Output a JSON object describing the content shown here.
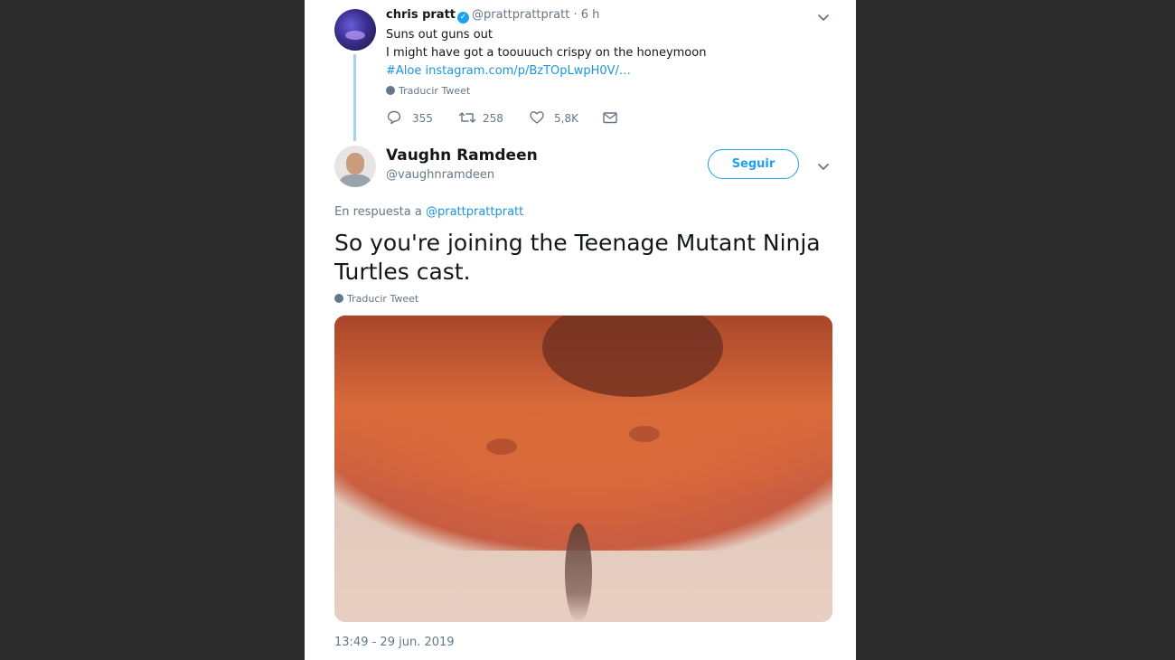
{
  "parent_tweet": {
    "display_name": "chris pratt",
    "handle": "@prattprattpratt",
    "time": "· 6 h",
    "lines": [
      "Suns out guns out",
      "I might have got a toouuuch crispy on the honeymoon"
    ],
    "hashtag": "#Aloe",
    "link": "instagram.com/p/BzTOpLwpH0V/…",
    "translate_label": "Traducir Tweet",
    "replies": "355",
    "retweets": "258",
    "likes": "5,8K"
  },
  "reply_tweet": {
    "display_name": "Vaughn Ramdeen",
    "handle": "@vaughnramdeen",
    "follow_label": "Seguir",
    "reply_to_prefix": "En respuesta a",
    "reply_to_handle": "@prattprattpratt",
    "text": "So you're joining the Teenage Mutant Ninja Turtles cast.",
    "translate_label": "Traducir Tweet",
    "timestamp": "13:49 - 29 jun. 2019"
  },
  "colors": {
    "link": "#1b95e0",
    "accent": "#1da1f2",
    "muted": "#657786",
    "text": "#14171a",
    "thread_line": "#a6d3ef",
    "background_dark": "#2b2b2b"
  },
  "icons": {
    "verified": "verified-badge-icon",
    "reply": "reply-icon",
    "retweet": "retweet-icon",
    "like": "heart-icon",
    "dm": "envelope-icon",
    "more": "chevron-down-icon",
    "translate": "globe-icon"
  }
}
